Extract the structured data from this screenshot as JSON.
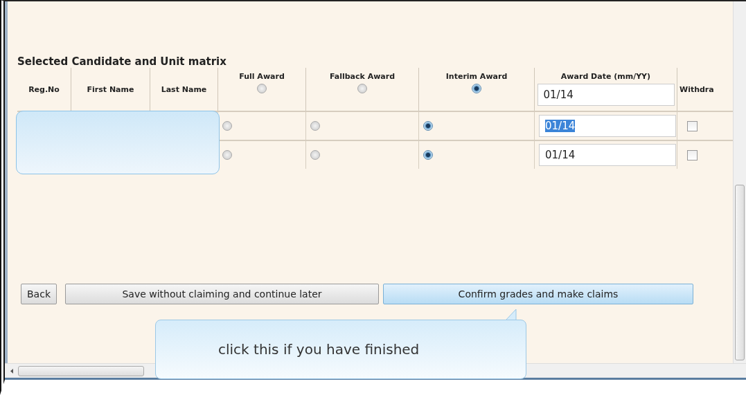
{
  "section_title": "Selected Candidate and Unit matrix",
  "columns": [
    {
      "kind": "text",
      "label": "Reg.No"
    },
    {
      "kind": "text",
      "label": "First Name"
    },
    {
      "kind": "text",
      "label": "Last Name"
    },
    {
      "kind": "radio",
      "label": "Full Award",
      "selected": false
    },
    {
      "kind": "radio",
      "label": "Fallback Award",
      "selected": false
    },
    {
      "kind": "radio",
      "label": "Interim Award",
      "selected": true
    },
    {
      "kind": "date",
      "label": "Award Date (mm/YY)",
      "value": "01/14"
    },
    {
      "kind": "check",
      "label": "Withdra"
    }
  ],
  "rows": [
    {
      "awards": [
        {
          "selected": false
        },
        {
          "selected": false
        },
        {
          "selected": true
        }
      ],
      "date": "01/14",
      "date_highlighted": true,
      "withdrawn": false
    },
    {
      "awards": [
        {
          "selected": false
        },
        {
          "selected": false
        },
        {
          "selected": true
        }
      ],
      "date": "01/14",
      "date_highlighted": false,
      "withdrawn": false
    }
  ],
  "buttons": [
    {
      "label": "Back",
      "primary": false
    },
    {
      "label": "Save without claiming and continue later",
      "primary": false
    },
    {
      "label": "Confirm grades and make claims",
      "primary": true
    }
  ],
  "callout": {
    "text": "click this if you have finished"
  }
}
